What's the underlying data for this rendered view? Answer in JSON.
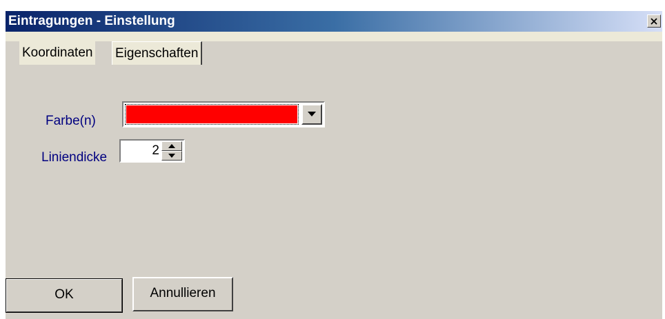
{
  "window": {
    "title": "Eintragungen - Einstellung",
    "close_glyph": "✕"
  },
  "tabs": [
    {
      "label": "Koordinaten",
      "active": false
    },
    {
      "label": "Eigenschaften",
      "active": true
    }
  ],
  "form": {
    "color_label": "Farbe(n)",
    "color_value": "#ff0000",
    "line_width_label": "Liniendicke",
    "line_width_value": "2"
  },
  "buttons": {
    "ok_label": "OK",
    "cancel_label": "Annullieren"
  },
  "icons": {
    "close": "close-icon",
    "dropdown": "chevron-down-icon",
    "spin_up": "spin-up-icon",
    "spin_down": "spin-down-icon"
  },
  "colors": {
    "title_gradient_start": "#0a246a",
    "face": "#d4d0c8",
    "label_text": "#000080"
  }
}
